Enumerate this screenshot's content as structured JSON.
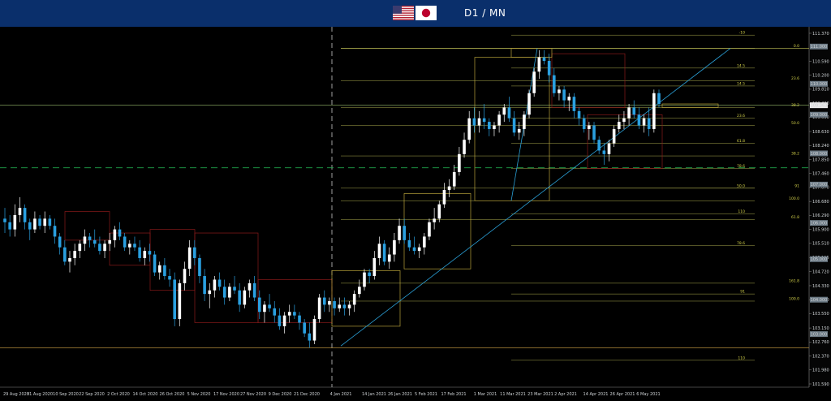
{
  "header": {
    "title": "D1 / MN",
    "flags": [
      "us-flag-icon",
      "jp-flag-icon"
    ],
    "background": "#0a2f6b"
  },
  "colors": {
    "bull": "#ffffff",
    "bear": "#2aa0e0",
    "fib": "#c8c85a",
    "monthly_box": "#8b1a1a",
    "trendline": "#2a9fd6",
    "price_line": "#9ed36a",
    "support_dashed": "#1fa64a"
  },
  "chart_data": {
    "type": "candlestick",
    "title": "D1 / MN",
    "symbol_pair": "USD/JPY",
    "ylim": [
      101.59,
      111.37
    ],
    "grid": false,
    "y_ticks": [
      "111.370",
      "110.590",
      "110.200",
      "109.810",
      "109.420",
      "109.030",
      "108.630",
      "108.240",
      "107.850",
      "107.460",
      "107.070",
      "106.680",
      "106.290",
      "105.900",
      "105.510",
      "105.115",
      "104.720",
      "104.330",
      "103.940",
      "103.550",
      "103.150",
      "102.760",
      "102.370",
      "101.980",
      "101.590"
    ],
    "y_boxes": [
      {
        "label": "111.000",
        "value": 111.0
      },
      {
        "label": "110.000",
        "value": 109.96
      },
      {
        "label": "109.363",
        "value": 109.363
      },
      {
        "label": "109.000",
        "value": 109.1
      },
      {
        "label": "108.000",
        "value": 108.02
      },
      {
        "label": "107.000",
        "value": 107.15
      },
      {
        "label": "106.000",
        "value": 106.08
      },
      {
        "label": "105.000",
        "value": 105.07
      },
      {
        "label": "104.000",
        "value": 103.94
      },
      {
        "label": "103.000",
        "value": 102.98
      }
    ],
    "current_price": 109.363,
    "x_labels": [
      "29 Aug 2020",
      "31 Aug 2020",
      "10 Sep 2020",
      "22 Sep 2020",
      "2 Oct 2020",
      "14 Oct 2020",
      "26 Oct 2020",
      "5 Nov 2020",
      "17 Nov 2020",
      "27 Nov 2020",
      "9 Dec 2020",
      "21 Dec 2020",
      "4 Jan 2021",
      "14 Jan 2021",
      "26 Jan 2021",
      "5 Feb 2021",
      "17 Feb 2021",
      "1 Mar 2021",
      "11 Mar 2021",
      "23 Mar 2021",
      "2 Apr 2021",
      "14 Apr 2021",
      "26 Apr 2021",
      "6 May 2021"
    ],
    "fib_levels_right": [
      {
        "label": "-10",
        "value": 111.32
      },
      {
        "label": "0.0",
        "value": 110.95
      },
      {
        "label": "14.5",
        "value": 110.4
      },
      {
        "label": "23.6",
        "value": 110.05
      },
      {
        "label": "14.5",
        "value": 109.9
      },
      {
        "label": "38.2",
        "value": 109.3
      },
      {
        "label": "23.6",
        "value": 109.0
      },
      {
        "label": "50.0",
        "value": 108.8
      },
      {
        "label": "61.8",
        "value": 108.3
      },
      {
        "label": "38.2",
        "value": 107.95
      },
      {
        "label": "78.6",
        "value": 107.6
      },
      {
        "label": "91",
        "value": 107.05
      },
      {
        "label": "50.0",
        "value": 107.05
      },
      {
        "label": "100.0",
        "value": 106.7
      },
      {
        "label": "110",
        "value": 106.33
      },
      {
        "label": "61.8",
        "value": 106.18
      },
      {
        "label": "78.6",
        "value": 105.45
      },
      {
        "label": "161.8",
        "value": 104.4
      },
      {
        "label": "91",
        "value": 104.1
      },
      {
        "label": "100.0",
        "value": 103.9
      },
      {
        "label": "110",
        "value": 102.25
      }
    ],
    "series": [
      {
        "name": "OHLC",
        "note": "daily candles",
        "values": [
          [
            106.2,
            106.5,
            105.8,
            106.1
          ],
          [
            106.1,
            106.3,
            105.7,
            105.9
          ],
          [
            105.9,
            106.6,
            105.7,
            106.3
          ],
          [
            106.3,
            106.8,
            106.1,
            106.5
          ],
          [
            106.5,
            106.6,
            105.9,
            106.1
          ],
          [
            106.1,
            106.2,
            105.6,
            105.9
          ],
          [
            105.9,
            106.4,
            105.8,
            106.2
          ],
          [
            106.2,
            106.3,
            105.9,
            106.0
          ],
          [
            106.0,
            106.4,
            105.8,
            106.2
          ],
          [
            106.2,
            106.3,
            105.9,
            106.0
          ],
          [
            106.0,
            106.2,
            105.5,
            105.7
          ],
          [
            105.7,
            105.8,
            105.2,
            105.4
          ],
          [
            105.4,
            105.6,
            104.9,
            105.0
          ],
          [
            105.0,
            105.3,
            104.7,
            105.1
          ],
          [
            105.1,
            105.5,
            104.9,
            105.3
          ],
          [
            105.3,
            105.6,
            105.1,
            105.5
          ],
          [
            105.5,
            105.9,
            105.3,
            105.7
          ],
          [
            105.7,
            105.8,
            105.4,
            105.6
          ],
          [
            105.6,
            105.9,
            105.4,
            105.5
          ],
          [
            105.5,
            105.7,
            105.2,
            105.3
          ],
          [
            105.3,
            105.6,
            105.1,
            105.5
          ],
          [
            105.5,
            105.8,
            105.3,
            105.6
          ],
          [
            105.6,
            106.0,
            105.4,
            105.9
          ],
          [
            105.9,
            106.1,
            105.6,
            105.7
          ],
          [
            105.7,
            105.8,
            105.3,
            105.4
          ],
          [
            105.4,
            105.6,
            105.2,
            105.5
          ],
          [
            105.5,
            105.7,
            105.3,
            105.4
          ],
          [
            105.4,
            105.6,
            105.0,
            105.1
          ],
          [
            105.1,
            105.4,
            104.9,
            105.3
          ],
          [
            105.3,
            105.5,
            105.0,
            105.2
          ],
          [
            105.2,
            105.3,
            104.6,
            104.7
          ],
          [
            104.7,
            105.0,
            104.5,
            104.9
          ],
          [
            104.9,
            105.1,
            104.5,
            104.6
          ],
          [
            104.6,
            104.8,
            104.3,
            104.5
          ],
          [
            104.5,
            104.7,
            103.2,
            103.4
          ],
          [
            103.4,
            104.5,
            103.2,
            104.4
          ],
          [
            104.4,
            105.0,
            104.2,
            104.8
          ],
          [
            104.8,
            105.6,
            104.6,
            105.4
          ],
          [
            105.4,
            105.6,
            104.9,
            105.1
          ],
          [
            105.1,
            105.2,
            104.4,
            104.6
          ],
          [
            104.6,
            104.8,
            103.9,
            104.1
          ],
          [
            104.1,
            104.4,
            103.7,
            104.2
          ],
          [
            104.2,
            104.6,
            104.0,
            104.5
          ],
          [
            104.5,
            104.7,
            104.2,
            104.3
          ],
          [
            104.3,
            104.5,
            103.8,
            104.0
          ],
          [
            104.0,
            104.4,
            103.9,
            104.3
          ],
          [
            104.3,
            104.6,
            104.1,
            104.2
          ],
          [
            104.2,
            104.4,
            103.6,
            103.8
          ],
          [
            103.8,
            104.3,
            103.7,
            104.2
          ],
          [
            104.2,
            104.5,
            104.0,
            104.4
          ],
          [
            104.4,
            104.6,
            103.9,
            104.0
          ],
          [
            104.0,
            104.2,
            103.4,
            103.6
          ],
          [
            103.6,
            103.9,
            103.3,
            103.8
          ],
          [
            103.8,
            104.1,
            103.6,
            103.7
          ],
          [
            103.7,
            103.9,
            103.3,
            103.5
          ],
          [
            103.5,
            103.7,
            103.1,
            103.2
          ],
          [
            103.2,
            103.6,
            103.0,
            103.5
          ],
          [
            103.5,
            103.8,
            103.3,
            103.6
          ],
          [
            103.6,
            103.8,
            103.4,
            103.5
          ],
          [
            103.5,
            103.6,
            103.1,
            103.3
          ],
          [
            103.3,
            103.4,
            102.9,
            103.0
          ],
          [
            103.0,
            103.3,
            102.6,
            102.8
          ],
          [
            102.8,
            103.5,
            102.7,
            103.4
          ],
          [
            103.4,
            104.1,
            103.3,
            104.0
          ],
          [
            104.0,
            104.2,
            103.6,
            103.8
          ],
          [
            103.8,
            104.0,
            103.6,
            103.9
          ],
          [
            103.9,
            104.0,
            103.5,
            103.7
          ],
          [
            103.7,
            104.0,
            103.6,
            103.8
          ],
          [
            103.8,
            104.0,
            103.5,
            103.7
          ],
          [
            103.7,
            103.9,
            103.5,
            103.8
          ],
          [
            103.8,
            104.2,
            103.6,
            104.1
          ],
          [
            104.1,
            104.5,
            104.0,
            104.3
          ],
          [
            104.3,
            104.8,
            104.2,
            104.7
          ],
          [
            104.7,
            104.8,
            104.4,
            104.6
          ],
          [
            104.6,
            105.3,
            104.5,
            105.1
          ],
          [
            105.1,
            105.7,
            104.9,
            105.5
          ],
          [
            105.5,
            105.6,
            104.9,
            105.0
          ],
          [
            105.0,
            105.4,
            104.8,
            105.2
          ],
          [
            105.2,
            105.8,
            105.0,
            105.6
          ],
          [
            105.6,
            106.2,
            105.5,
            106.0
          ],
          [
            106.0,
            106.2,
            105.5,
            105.6
          ],
          [
            105.6,
            105.8,
            105.3,
            105.4
          ],
          [
            105.4,
            105.7,
            105.2,
            105.3
          ],
          [
            105.3,
            105.5,
            105.1,
            105.4
          ],
          [
            105.4,
            105.8,
            105.2,
            105.7
          ],
          [
            105.7,
            106.2,
            105.6,
            106.1
          ],
          [
            106.1,
            106.5,
            105.9,
            106.2
          ],
          [
            106.2,
            106.7,
            106.1,
            106.6
          ],
          [
            106.6,
            107.2,
            106.5,
            107.0
          ],
          [
            107.0,
            107.3,
            106.8,
            107.1
          ],
          [
            107.1,
            107.7,
            107.0,
            107.5
          ],
          [
            107.5,
            108.2,
            107.4,
            108.0
          ],
          [
            108.0,
            108.6,
            107.9,
            108.4
          ],
          [
            108.4,
            109.2,
            108.3,
            109.0
          ],
          [
            109.0,
            109.3,
            108.6,
            108.8
          ],
          [
            108.8,
            109.2,
            108.6,
            109.0
          ],
          [
            109.0,
            109.4,
            108.7,
            108.9
          ],
          [
            108.9,
            109.0,
            108.5,
            108.7
          ],
          [
            108.7,
            108.9,
            108.5,
            108.8
          ],
          [
            108.8,
            109.2,
            108.6,
            109.1
          ],
          [
            109.1,
            109.4,
            108.9,
            109.3
          ],
          [
            109.3,
            109.6,
            108.9,
            109.0
          ],
          [
            109.0,
            109.2,
            108.5,
            108.6
          ],
          [
            108.6,
            108.9,
            108.4,
            108.7
          ],
          [
            108.7,
            109.2,
            108.5,
            109.1
          ],
          [
            109.1,
            109.8,
            109.0,
            109.7
          ],
          [
            109.7,
            110.4,
            109.6,
            110.3
          ],
          [
            110.3,
            110.9,
            110.1,
            110.7
          ],
          [
            110.7,
            110.9,
            110.5,
            110.6
          ],
          [
            110.6,
            110.8,
            110.0,
            110.2
          ],
          [
            110.2,
            110.4,
            109.6,
            109.7
          ],
          [
            109.7,
            109.9,
            109.5,
            109.8
          ],
          [
            109.8,
            109.9,
            109.3,
            109.5
          ],
          [
            109.5,
            109.7,
            109.2,
            109.6
          ],
          [
            109.6,
            109.7,
            109.0,
            109.2
          ],
          [
            109.2,
            109.3,
            108.8,
            109.0
          ],
          [
            109.0,
            109.1,
            108.6,
            108.7
          ],
          [
            108.7,
            108.9,
            108.4,
            108.8
          ],
          [
            108.8,
            108.9,
            108.3,
            108.4
          ],
          [
            108.4,
            108.5,
            108.0,
            108.1
          ],
          [
            108.1,
            108.3,
            107.7,
            108.0
          ],
          [
            108.0,
            108.4,
            107.8,
            108.3
          ],
          [
            108.3,
            108.8,
            108.2,
            108.7
          ],
          [
            108.7,
            109.1,
            108.6,
            108.9
          ],
          [
            108.9,
            109.2,
            108.7,
            109.0
          ],
          [
            109.0,
            109.4,
            108.8,
            109.3
          ],
          [
            109.3,
            109.5,
            109.0,
            109.1
          ],
          [
            109.1,
            109.3,
            108.7,
            108.8
          ],
          [
            108.8,
            109.1,
            108.6,
            109.0
          ],
          [
            109.0,
            109.3,
            108.5,
            108.7
          ],
          [
            108.7,
            109.8,
            108.6,
            109.7
          ],
          [
            109.7,
            109.8,
            109.3,
            109.4
          ]
        ]
      }
    ]
  }
}
